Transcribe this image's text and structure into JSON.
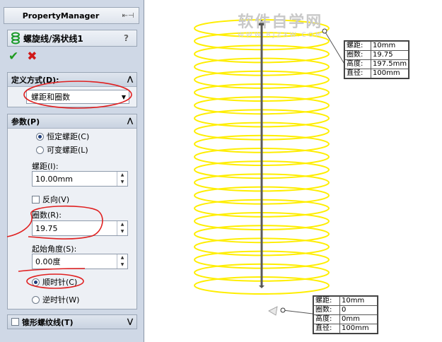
{
  "pm": {
    "title": "PropertyManager"
  },
  "feature": {
    "name": "螺旋线/涡状线1",
    "help": "?"
  },
  "buttons": {
    "ok": "✔",
    "cancel": "✖"
  },
  "define_by": {
    "header": "定义方式(D):",
    "value": "螺距和圈数"
  },
  "params": {
    "header": "参数(P)",
    "constant_pitch": "恒定螺距(C)",
    "variable_pitch": "可变螺距(L)",
    "pitch_label": "螺距(I):",
    "pitch_value": "10.00mm",
    "reverse_label": "反向(V)",
    "revolutions_label": "圈数(R):",
    "revolutions_value": "19.75",
    "start_angle_label": "起始角度(S):",
    "start_angle_value": "0.00度",
    "clockwise": "顺时针(C)",
    "counterclockwise": "逆时针(W)"
  },
  "taper": {
    "header": "锥形螺纹线(T)"
  },
  "callout_top": [
    {
      "k": "螺距:",
      "v": "10mm"
    },
    {
      "k": "圈数:",
      "v": "19.75"
    },
    {
      "k": "高度:",
      "v": "197.5mm"
    },
    {
      "k": "直径:",
      "v": "100mm"
    }
  ],
  "callout_bottom": [
    {
      "k": "螺距:",
      "v": "10mm"
    },
    {
      "k": "圈数:",
      "v": "0"
    },
    {
      "k": "高度:",
      "v": "0mm"
    },
    {
      "k": "直径:",
      "v": "100mm"
    }
  ],
  "watermark": {
    "line1": "软件自学网",
    "line2": "WWW.RJZXW.COM"
  },
  "colors": {
    "helix": "#ffee00",
    "annotation": "#e02020",
    "panel": "#cfd8e6"
  },
  "helix": {
    "revolutions": 19.75
  }
}
